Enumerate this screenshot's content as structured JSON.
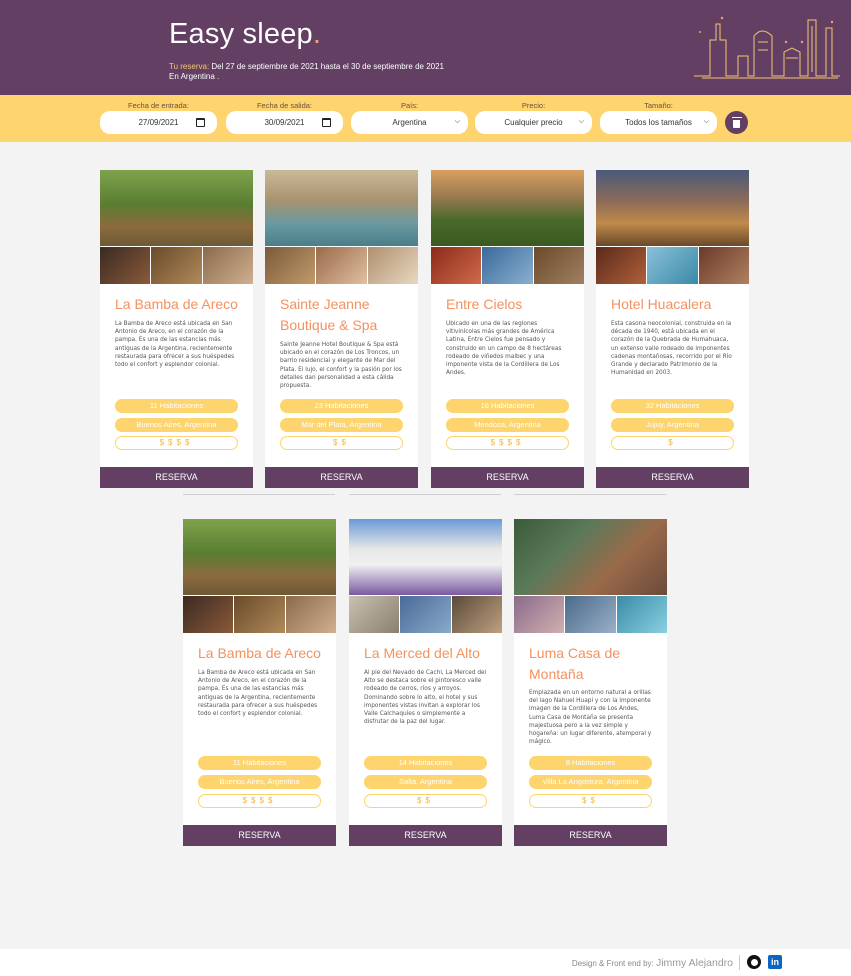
{
  "header": {
    "brand": "Easy sleep",
    "brand_dot": ".",
    "reserva_label": "Tu reserva:",
    "reserva_text": " Del 27 de septiembre de 2021 hasta el 30 de septiembre de 2021",
    "reserva_location": "En Argentina ."
  },
  "filters": {
    "checkin_label": "Fecha de entrada:",
    "checkin_value": "27/09/2021",
    "checkout_label": "Fecha de salida:",
    "checkout_value": "30/09/2021",
    "country_label": "País:",
    "country_value": "Argentina",
    "price_label": "Precio:",
    "price_value": "Cualquier precio",
    "size_label": "Tamaño:",
    "size_value": "Todos los tamaños"
  },
  "hotels": [
    {
      "name": "La Bamba de Areco",
      "description": "La Bamba de Areco está ubicada en San Antonio de Areco, en el corazón de la pampa. Es una de las estancias más antiguas de la Argentina, recientemente restaurada para ofrecer a sus huéspedes todo el confort y esplendor colonial.",
      "rooms": "11 Habitaciones",
      "location": "Buenos Aires, Argentina",
      "price": "$$$$",
      "button": "RESERVA"
    },
    {
      "name": "Sainte Jeanne Boutique & Spa",
      "description": "Sainte Jeanne Hotel Boutique & Spa está ubicado en el corazón de Los Troncos, un barrio residencial y elegante de Mar del Plata. El lujo, el confort y la pasión por los detalles dan personalidad a esta cálida propuesta.",
      "rooms": "23 Habitaciones",
      "location": "Mar del Plata, Argentina",
      "price": "$$",
      "button": "RESERVA"
    },
    {
      "name": "Entre Cielos",
      "description": "Ubicado en una de las regiones vitivinícolas más grandes de América Latina, Entre Cielos fue pensado y construido en un campo de 8 hectáreas rodeado de viñedos malbec y una imponente vista de la Cordillera de Los Andes.",
      "rooms": "16 Habitaciones",
      "location": "Mendoza, Argentina",
      "price": "$$$$",
      "button": "RESERVA"
    },
    {
      "name": "Hotel Huacalera",
      "description": "Esta casona neocolonial, construida en la década de 1940, está ubicada en el corazón de la Quebrada de Humahuaca, un extenso valle rodeado de imponentes cadenas montañosas, recorrido por el Río Grande y declarado Patrimonio de la Humanidad en 2003.",
      "rooms": "32 Habitaciones",
      "location": "Jujuy, Argentina",
      "price": "$",
      "button": "RESERVA"
    },
    {
      "name": "La Bamba de Areco",
      "description": "La Bamba de Areco está ubicada en San Antonio de Areco, en el corazón de la pampa. Es una de las estancias más antiguas de la Argentina, recientemente restaurada para ofrecer a sus huéspedes todo el confort y esplendor colonial.",
      "rooms": "11 Habitaciones",
      "location": "Buenos Aires, Argentina",
      "price": "$$$$",
      "button": "RESERVA"
    },
    {
      "name": "La Merced del Alto",
      "description": "Al pie del Nevado de Cachi, La Merced del Alto se destaca sobre el pintoresco valle rodeado de cerros, ríos y arroyos. Dominando sobre lo alto, el hotel y sus imponentes vistas invitan a explorar los Valle Calchaquíes o simplemente a disfrutar de la paz del lugar.",
      "rooms": "14 Habitaciones",
      "location": "Salta, Argentina",
      "price": "$$",
      "button": "RESERVA"
    },
    {
      "name": "Luma Casa de Montaña",
      "description": "Emplazada en un entorno natural a orillas del lago Nahuel Huapi y con la imponente imagen de la Cordillera de Los Andes, Luma Casa de Montaña se presenta majestuosa pero a la vez simple y hogareña: un lugar diferente, atemporal y mágico.",
      "rooms": "8 Habitaciones",
      "location": "Villa La Angostura, Argentina",
      "price": "$$",
      "button": "RESERVA"
    }
  ],
  "footer": {
    "credit_prefix": "Design & Front end by: ",
    "credit_name": "Jimmy Alejandro",
    "linkedin_glyph": "in"
  },
  "colors": {
    "primary": "#633f64",
    "accent": "#fdd46d",
    "title": "#f4915f"
  }
}
